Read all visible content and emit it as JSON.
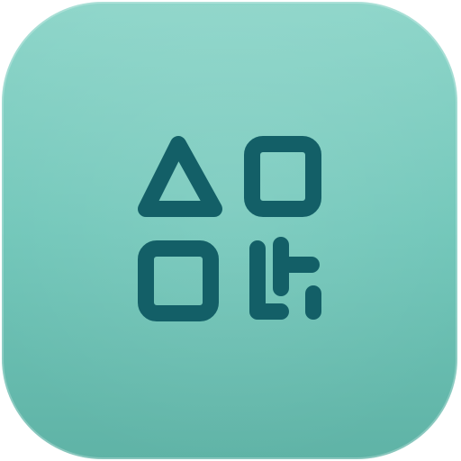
{
  "app_icon": {
    "icon": "shapes-qr-code-icon",
    "colors": {
      "tile_base": "#72c7ba",
      "tile_highlight": "#8fd6ca",
      "tile_shadow": "#5fb3a6",
      "glyph": "#135f67"
    }
  }
}
